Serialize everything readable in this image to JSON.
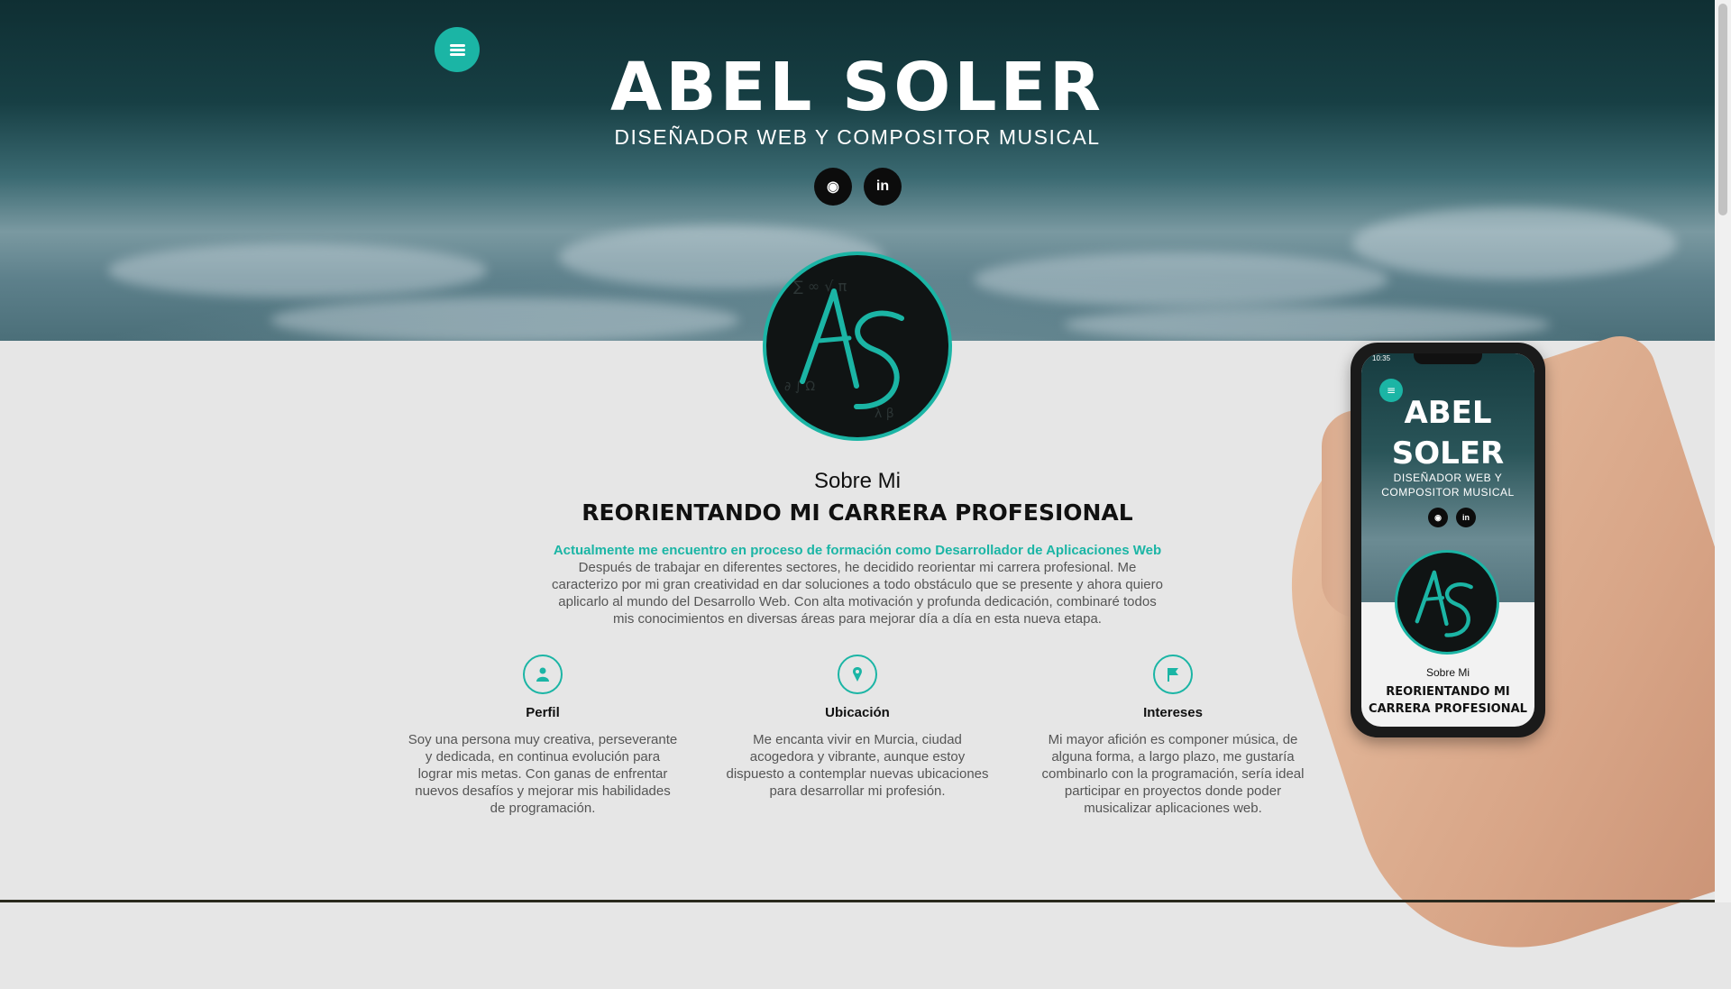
{
  "header": {
    "menu_icon": "menu-icon",
    "title": "ABEL SOLER",
    "subtitle": "DISEÑADOR WEB Y COMPOSITOR MUSICAL",
    "social": [
      {
        "name": "github",
        "icon": "github-icon",
        "glyph": "◉"
      },
      {
        "name": "linkedin",
        "icon": "linkedin-icon",
        "glyph": "in"
      }
    ]
  },
  "about": {
    "label": "Sobre Mi",
    "title": "REORIENTANDO MI CARRERA PROFESIONAL",
    "highlight": "Actualmente me encuentro en proceso de formación como Desarrollador de Aplicaciones Web",
    "paragraph": "Después de trabajar en diferentes sectores, he decidido reorientar mi carrera profesional. Me caracterizo por mi gran creatividad en dar soluciones a todo obstáculo que se presente y ahora quiero aplicarlo al mundo del Desarrollo Web. Con alta motivación y profunda dedicación, combinaré todos mis conocimientos en diversas áreas para mejorar día a día en esta nueva etapa."
  },
  "features": [
    {
      "icon": "user-icon",
      "title": "Perfil",
      "text": "Soy una persona muy creativa, perseverante y dedicada, en continua evolución para lograr mis metas. Con ganas de enfrentar nuevos desafíos y mejorar mis habilidades de programación."
    },
    {
      "icon": "location-pin-icon",
      "title": "Ubicación",
      "text": "Me encanta vivir en Murcia, ciudad acogedora y vibrante, aunque estoy dispuesto a contemplar nuevas ubicaciones para desarrollar mi profesión."
    },
    {
      "icon": "flag-icon",
      "title": "Intereses",
      "text": "Mi mayor afición es componer música, de alguna forma, a largo plazo, me gustaría combinarlo con la programación, sería ideal participar en proyectos donde poder musicalizar aplicaciones web."
    }
  ],
  "phone": {
    "time": "10:35",
    "title": "ABEL SOLER",
    "subtitle": "DISEÑADOR WEB Y COMPOSITOR MUSICAL",
    "label": "Sobre Mi",
    "heading": "REORIENTANDO MI CARRERA PROFESIONAL"
  },
  "colors": {
    "accent": "#1bb5a5",
    "background": "#e6e6e6",
    "text_dark": "#111111",
    "text_muted": "#555555"
  }
}
